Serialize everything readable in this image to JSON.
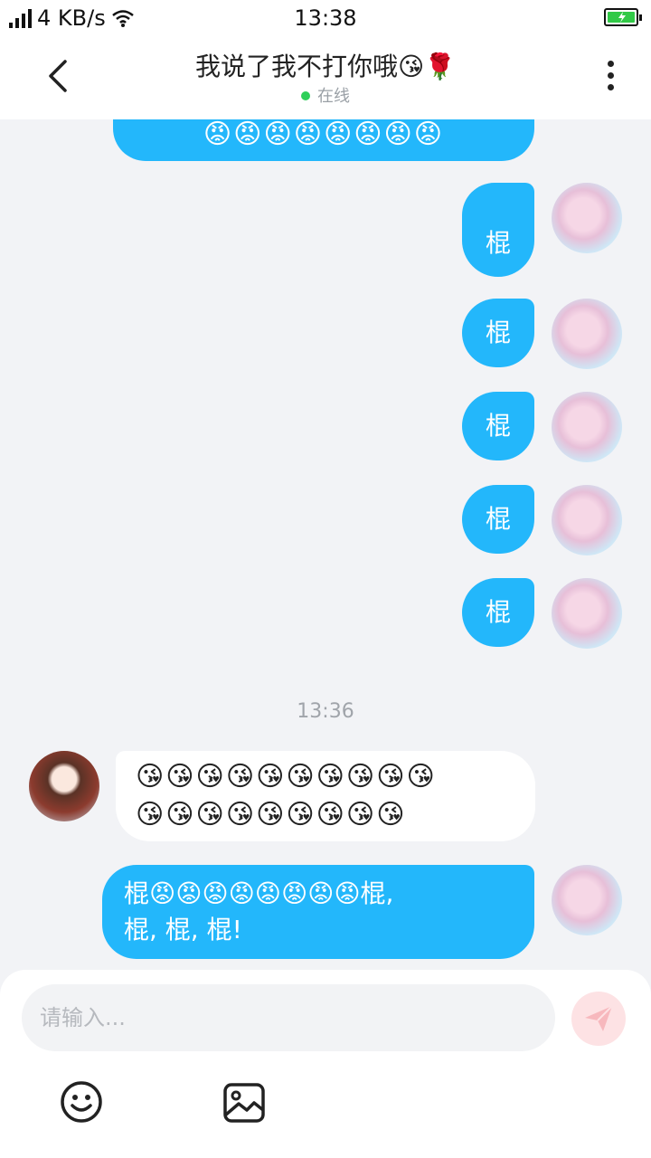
{
  "status_bar": {
    "network": "4 KB/s",
    "time": "13:38"
  },
  "header": {
    "title": "我说了我不打你哦😘🌹",
    "status": "在线"
  },
  "messages": [
    {
      "text": "😡😡😡😡😡😡😡😡"
    },
    {
      "text": "棍"
    },
    {
      "text": "棍"
    },
    {
      "text": "棍"
    },
    {
      "text": "棍"
    },
    {
      "text": "棍"
    },
    {
      "text_line1": "😘😘😘😘😘😘😘😘😘😘",
      "text_line2": "😘😘😘😘😘😘😘😘😘"
    },
    {
      "text_line1": "棍😡😡😡😡😡😡😡😡棍,",
      "text_line2": "棍, 棍, 棍!"
    }
  ],
  "timestamp": "13:36",
  "input": {
    "placeholder": "请输入..."
  },
  "icons": {
    "back": "chevron-left-icon",
    "more": "more-vertical-icon",
    "send": "send-icon",
    "emoji": "smiley-icon",
    "image": "image-icon"
  },
  "colors": {
    "accent": "#23b7fb",
    "online": "#2fcf59",
    "background": "#f2f3f6"
  }
}
